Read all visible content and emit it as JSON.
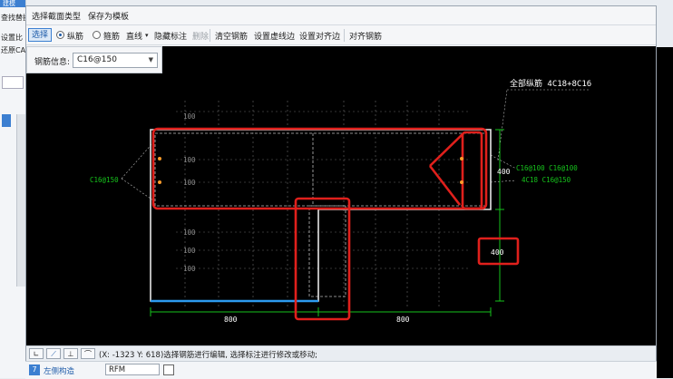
{
  "background_app": {
    "tab_title": "建模",
    "left_labels": [
      "查找替换",
      "设置比",
      "还原CA"
    ],
    "bottom_row": {
      "index": "7",
      "name": "左侧构造",
      "value": "RFM"
    }
  },
  "menu": {
    "items": [
      "选择截面类型",
      "保存为模板"
    ]
  },
  "toolbar": {
    "select": "选择",
    "longitudinal": "纵筋",
    "stirrup": "箍筋",
    "line": "直线",
    "hide_label": "隐藏标注",
    "delete": "删除",
    "clear": "清空钢筋",
    "set_edge": "设置虚线边",
    "set_align_edge": "设置对齐边",
    "align_rebar": "对齐钢筋"
  },
  "rebar_info": {
    "label": "钢筋信息:",
    "value": "C16@150"
  },
  "drawing": {
    "total_label": "全部纵筋 4C18+8C16",
    "left_note": "C16@150",
    "right_note_1": "C16@100 C16@100",
    "right_note_2": "4C18   C16@150",
    "dim_100": "100",
    "dim_400_a": "400",
    "dim_400_b": "400",
    "dim_800_a": "800",
    "dim_800_b": "800"
  },
  "status": {
    "text": "(X: -1323 Y: 618)选择钢筋进行编辑, 选择标注进行修改或移动;"
  },
  "colors": {
    "accent": "#3c7fd1",
    "highlight": "#e0201c",
    "outline": "#e6e6e6",
    "dim": "#16c21c"
  }
}
